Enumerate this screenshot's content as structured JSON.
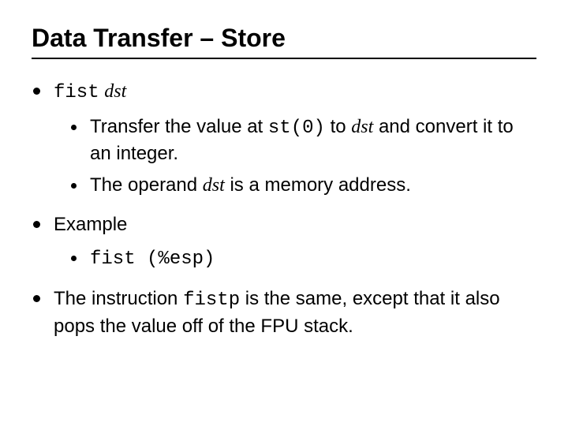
{
  "title": "Data Transfer – Store",
  "item1": {
    "code": "fist",
    "argItalic": "dst",
    "sub1": {
      "p1": "Transfer the value at ",
      "code": "st(0)",
      "p2": " to ",
      "it1": "dst",
      "p3": " and convert it to an integer."
    },
    "sub2": {
      "p1": "The operand ",
      "it1": "dst",
      "p2": " is a memory address."
    }
  },
  "item2": {
    "label": "Example",
    "sub1": {
      "code": "fist (%esp)"
    }
  },
  "item3": {
    "p1": "The instruction ",
    "code": "fistp",
    "p2": " is the same, except that it also pops the value off of the FPU stack."
  }
}
